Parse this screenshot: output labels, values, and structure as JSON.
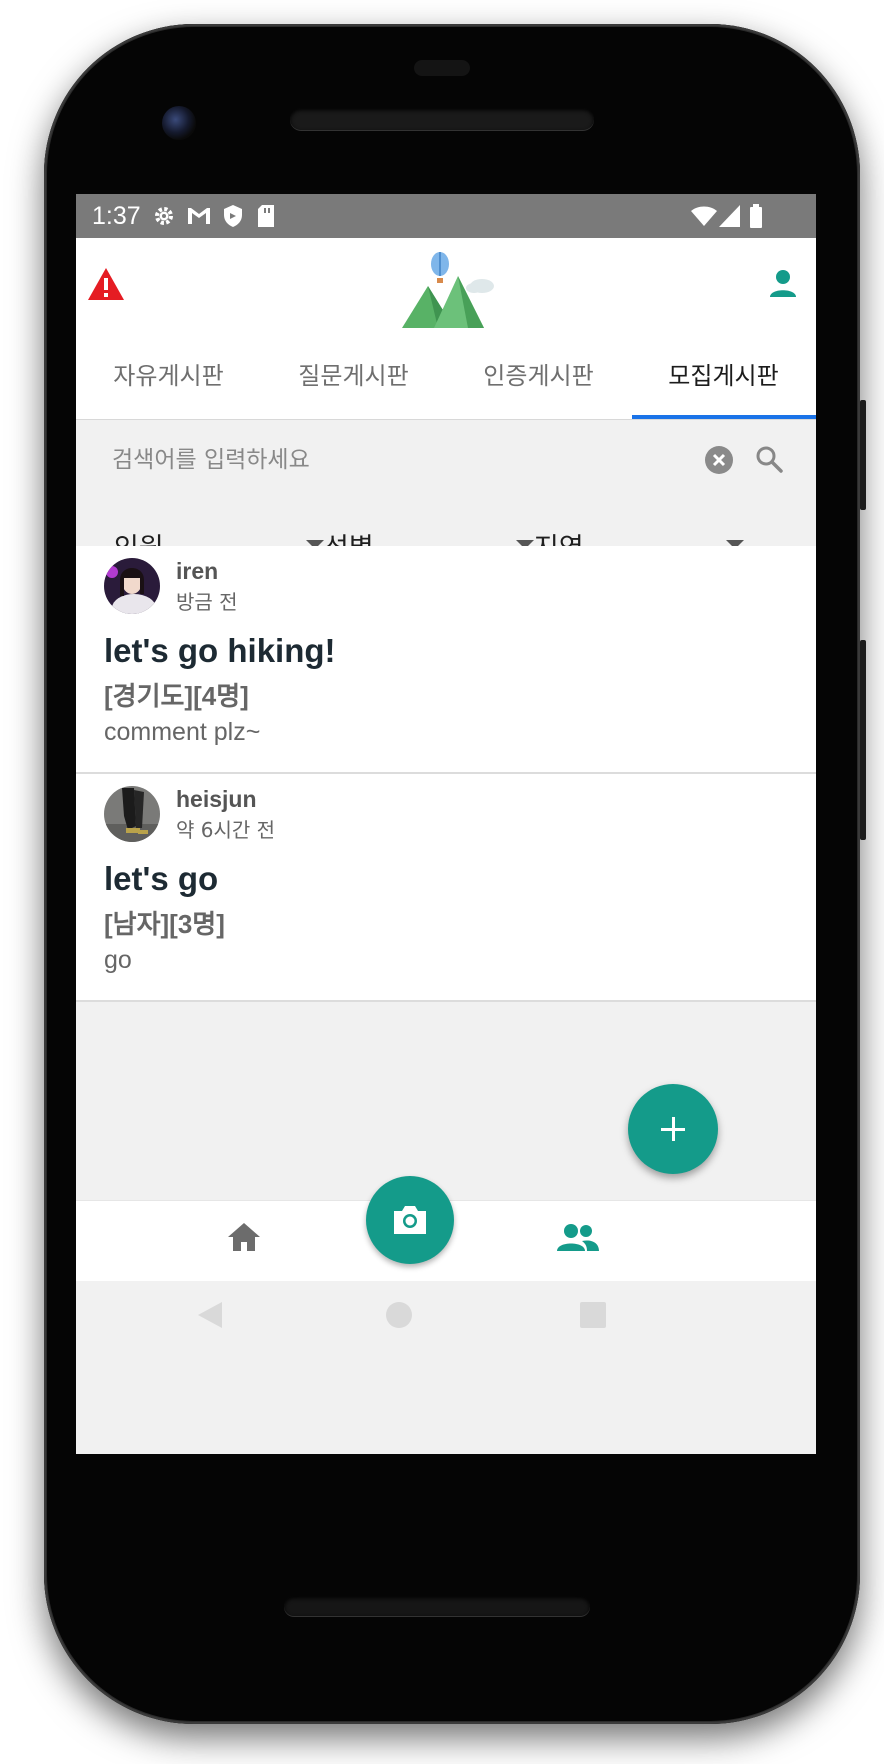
{
  "status_bar": {
    "time": "1:37",
    "left_icons": [
      "settings-icon",
      "gmail-icon",
      "shield-icon",
      "sd-card-icon"
    ],
    "right_icons": [
      "wifi-icon",
      "signal-icon",
      "battery-icon"
    ]
  },
  "app_bar": {
    "left_icon": "warning-icon",
    "logo": "mountain-balloon-logo",
    "right_icon": "person-icon"
  },
  "tabs": [
    {
      "label": "자유게시판",
      "active": false
    },
    {
      "label": "질문게시판",
      "active": false
    },
    {
      "label": "인증게시판",
      "active": false
    },
    {
      "label": "모집게시판",
      "active": true
    }
  ],
  "search": {
    "placeholder": "검색어를 입력하세요",
    "value": ""
  },
  "filters": [
    {
      "label": "인원"
    },
    {
      "label": "성별"
    },
    {
      "label": "지역"
    }
  ],
  "posts": [
    {
      "author": "iren",
      "time": "방금 전",
      "title": "let's go hiking!",
      "tags": "[경기도][4명]",
      "body": "comment plz~"
    },
    {
      "author": "heisjun",
      "time": "약 6시간 전",
      "title": "let's go",
      "tags": "[남자][3명]",
      "body": "go"
    }
  ],
  "fab": {
    "icon": "plus-icon"
  },
  "bottom_nav": {
    "items": [
      "home-icon",
      "camera-icon",
      "group-icon"
    ],
    "accent": "#149b8a"
  },
  "colors": {
    "accent": "#149b8a",
    "tab_indicator": "#1a73e8",
    "warning": "#e51c23"
  }
}
